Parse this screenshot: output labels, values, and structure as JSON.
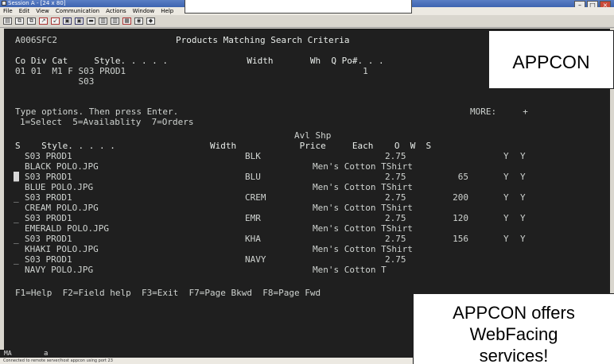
{
  "window": {
    "title": "Session A - [24 x 80]",
    "buttons": [
      "–",
      "□",
      "×"
    ]
  },
  "menu": [
    "File",
    "Edit",
    "View",
    "Communication",
    "Actions",
    "Window",
    "Help"
  ],
  "toolbar_icons": [
    "print-icon",
    "copy-icon",
    "paste-icon",
    "send-icon",
    "receive-icon",
    "display-icon",
    "record-icon",
    "play-icon",
    "macro-icon",
    "map-icon",
    "popup-keypad-icon",
    "color-icon",
    "help-icon"
  ],
  "screen": {
    "program": "A006SFC2",
    "heading": "Products Matching Search Criteria",
    "crit_header": "Co Div Cat     Style. . . . .               Width       Wh  Q Po#. . .",
    "crit_values1": "01 01  M1 F S03 PROD1                                             1",
    "crit_values2": "            S03",
    "instructions": "Type options. Then press Enter.",
    "options": "1=Select  5=Availablity  7=Orders",
    "more": "MORE:     +",
    "col_header1": "                                                     Avl Shp",
    "col_header2": "S    Style. . . . .                  Width            Price     Each    O  W  S",
    "rows": [
      {
        "sel": " ",
        "style": "S03 PROD1",
        "width": "BLK",
        "price": "2.75",
        "each": "",
        "o": "Y",
        "w": "Y",
        "image": "BLACK POLO.JPG",
        "desc": "Men's Cotton TShirt"
      },
      {
        "sel": "_",
        "style": "S03 PROD1",
        "width": "BLU",
        "price": "2.75",
        "each": "65",
        "o": "Y",
        "w": "Y",
        "image": "BLUE POLO.JPG",
        "desc": "Men's Cotton TShirt"
      },
      {
        "sel": "_",
        "style": "S03 PROD1",
        "width": "CREM",
        "price": "2.75",
        "each": "200",
        "o": "Y",
        "w": "Y",
        "image": "CREAM POLO.JPG",
        "desc": "Men's Cotton TShirt"
      },
      {
        "sel": "_",
        "style": "S03 PROD1",
        "width": "EMR",
        "price": "2.75",
        "each": "120",
        "o": "Y",
        "w": "Y",
        "image": "EMERALD POLO.JPG",
        "desc": "Men's Cotton TShirt"
      },
      {
        "sel": "_",
        "style": "S03 PROD1",
        "width": "KHA",
        "price": "2.75",
        "each": "156",
        "o": "Y",
        "w": "Y",
        "image": "KHAKI POLO.JPG",
        "desc": "Men's Cotton TShirt"
      },
      {
        "sel": "_",
        "style": "S03 PROD1",
        "width": "NAVY",
        "price": "2.75",
        "each": "",
        "o": "",
        "w": "",
        "image": "NAVY POLO.JPG",
        "desc": "Men's Cotton T"
      }
    ],
    "fkeys": "F1=Help  F2=Field help  F3=Exit  F7=Page Bkwd  F8=Page Fwd"
  },
  "oia": {
    "indicator": "MA",
    "field": "a"
  },
  "status": {
    "text": "Connected to remote server/host appcon using port 23"
  },
  "callouts": {
    "appcon": "APPCON",
    "line1": "APPCON offers",
    "line2": "WebFacing",
    "line3": "services!"
  },
  "colors": {
    "terminal_bg": "#1f1f1f",
    "terminal_text": "#cfd3d0",
    "titlebar": "#3d64b0",
    "chrome": "#d9d6ce"
  }
}
